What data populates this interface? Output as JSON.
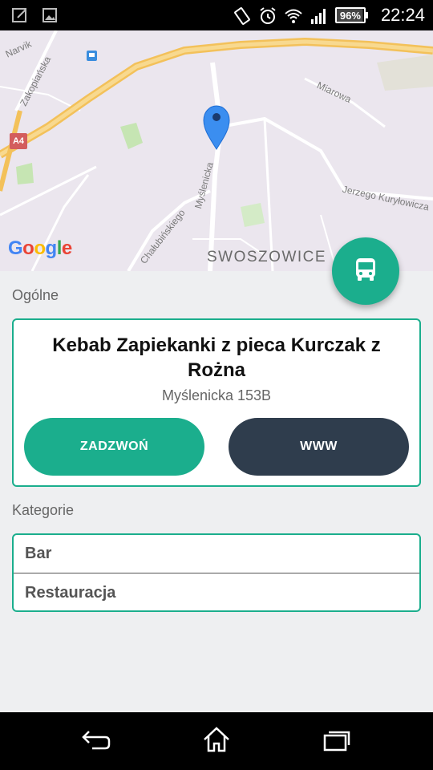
{
  "status_bar": {
    "battery": "96%",
    "time": "22:24"
  },
  "map": {
    "labels": {
      "narvik": "Narvik",
      "zakopianska": "Zakopiańska",
      "miarowa": "Miarowa",
      "myslenicka": "Myślenicka",
      "chalubinskiego": "Chałubińskiego",
      "kurylowicza": "Jerzego Kuryłowicza",
      "district": "SWOSZOWICE",
      "road_badge": "A4"
    },
    "google_logo": "Google"
  },
  "general": {
    "section_label": "Ogólne",
    "title": "Kebab Zapiekanki z pieca Kurczak z Rożna",
    "address": "Myślenicka 153B",
    "call_label": "ZADZWOŃ",
    "www_label": "WWW"
  },
  "categories": {
    "section_label": "Kategorie",
    "items": [
      "Bar",
      "Restauracja"
    ]
  },
  "colors": {
    "accent": "#1bae8d",
    "dark_button": "#2f3d4d",
    "background": "#eeeff1"
  },
  "icons": {
    "fab": "bus-icon",
    "nav": [
      "back-icon",
      "home-icon",
      "recents-icon"
    ]
  }
}
